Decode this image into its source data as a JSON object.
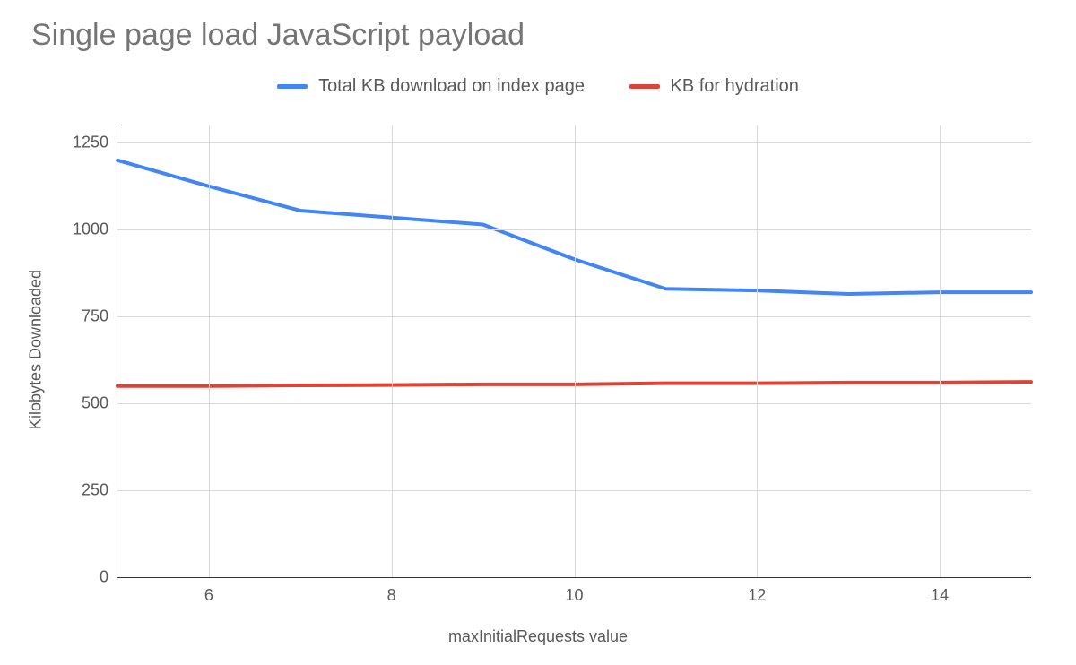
{
  "title": "Single page load JavaScript payload",
  "legend": {
    "series1": "Total KB download on index page",
    "series2": "KB for hydration"
  },
  "axes": {
    "xlabel": "maxInitialRequests value",
    "ylabel": "Kilobytes Downloaded"
  },
  "chart_data": {
    "type": "line",
    "xlabel": "maxInitialRequests value",
    "ylabel": "Kilobytes Downloaded",
    "title": "Single page load JavaScript payload",
    "x": [
      5,
      6,
      7,
      8,
      9,
      10,
      11,
      12,
      13,
      14,
      15
    ],
    "xlim": [
      5,
      15
    ],
    "ylim": [
      0,
      1300
    ],
    "yticks": [
      0,
      250,
      500,
      750,
      1000,
      1250
    ],
    "xticks": [
      6,
      8,
      10,
      12,
      14
    ],
    "series": [
      {
        "name": "Total KB download on index page",
        "color": "#4285f4",
        "values": [
          1200,
          1125,
          1055,
          1035,
          1015,
          915,
          830,
          825,
          815,
          820,
          820
        ]
      },
      {
        "name": "KB for hydration",
        "color": "#db4437",
        "values": [
          550,
          550,
          552,
          553,
          555,
          555,
          558,
          558,
          560,
          560,
          562
        ]
      }
    ]
  }
}
